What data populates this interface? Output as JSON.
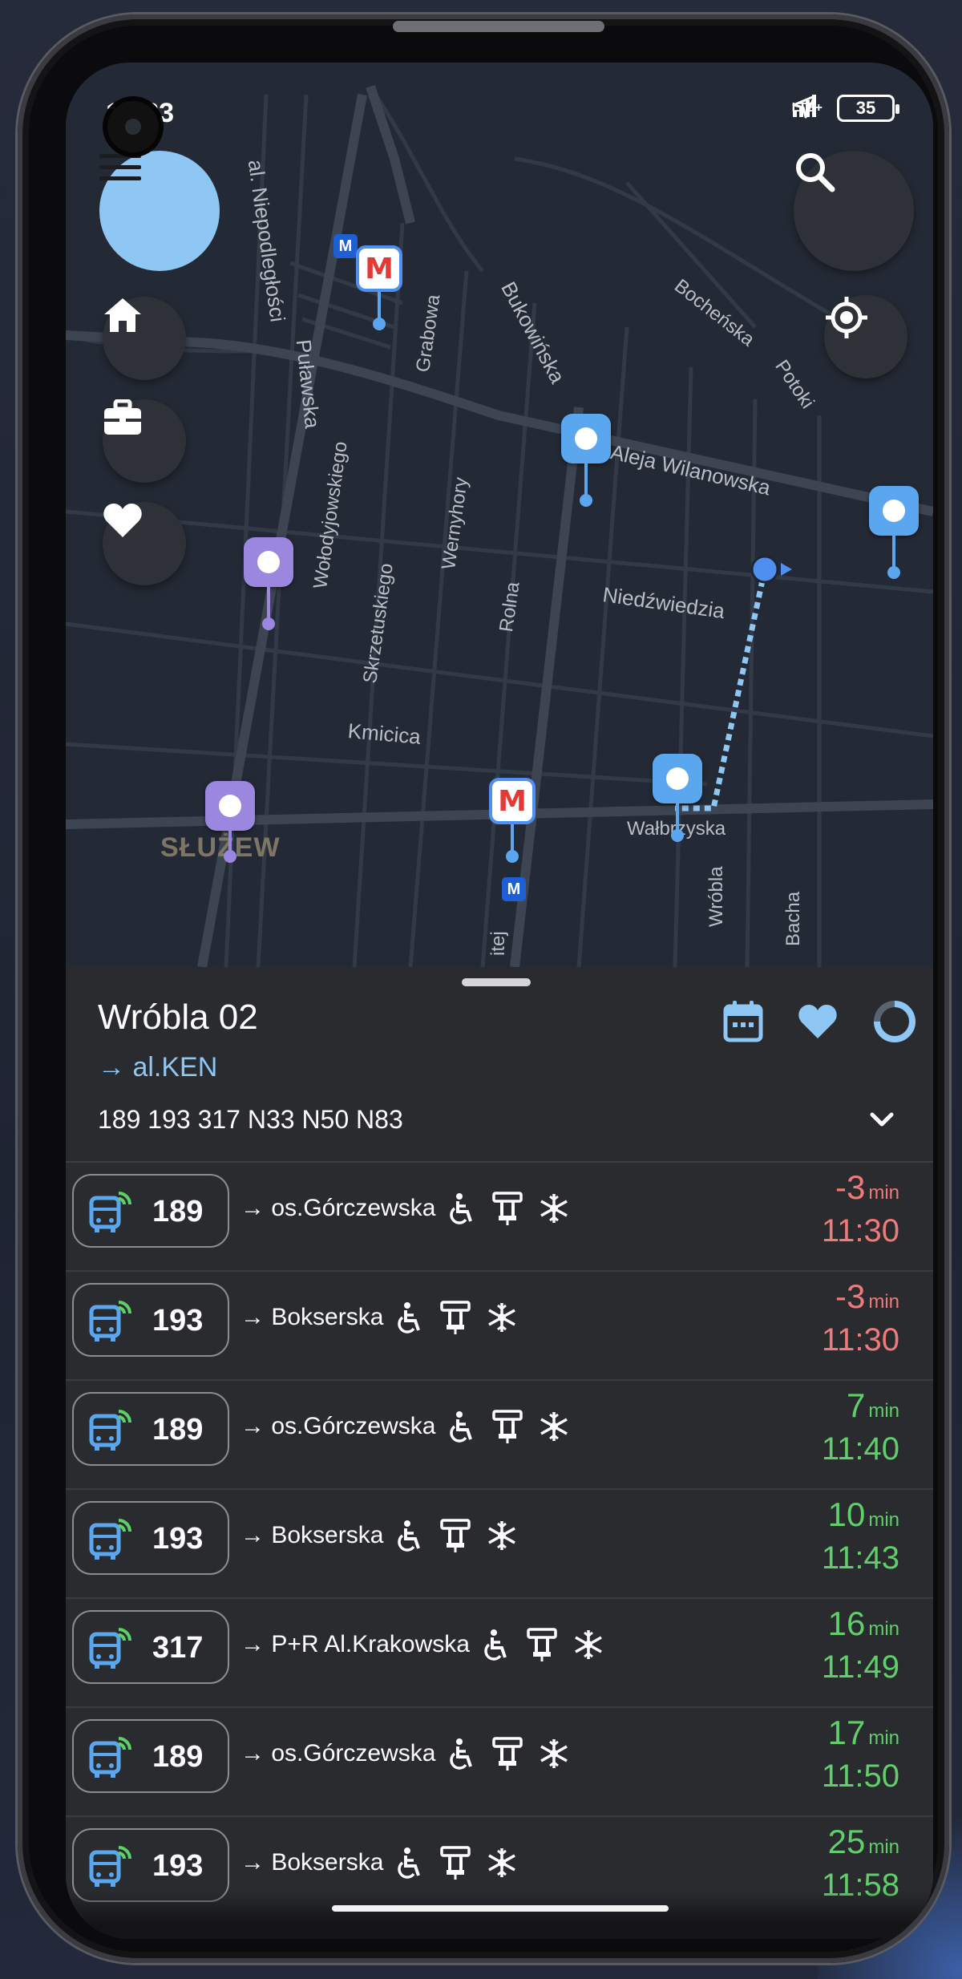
{
  "status": {
    "time": "11:33",
    "network": "LTE+",
    "battery": "35"
  },
  "map": {
    "streets": [
      {
        "label": "al. Niepodległości"
      },
      {
        "label": "Puławska"
      },
      {
        "label": "Grabowa"
      },
      {
        "label": "Bukowińska"
      },
      {
        "label": "Bocheńska"
      },
      {
        "label": "Potoki"
      },
      {
        "label": "Aleja Wilanowska"
      },
      {
        "label": "Wołodyjowskiego"
      },
      {
        "label": "Skrzetuskiego"
      },
      {
        "label": "Wernyhory"
      },
      {
        "label": "Rolna"
      },
      {
        "label": "Niedźwiedzia"
      },
      {
        "label": "Kmicica"
      },
      {
        "label": "Wałbrzyska"
      },
      {
        "label": "Wróbla"
      },
      {
        "label": "Bacha"
      },
      {
        "label": "itej"
      }
    ],
    "district": "SŁUŻEW",
    "metro_letter": "M"
  },
  "colors": {
    "accent": "#8ec6f4",
    "late": "#ef7a7a",
    "on_time": "#5fcf6a",
    "purple_stop": "#9b86e0",
    "blue_stop": "#5aa7f0"
  },
  "stop": {
    "name": "Wróbla 02",
    "direction": "→ al.KEN",
    "lines": "189 193 317 N33 N50 N83",
    "icons": [
      "calendar-icon",
      "heart-icon",
      "refresh-progress-icon",
      "chevron-down-icon"
    ]
  },
  "departures": [
    {
      "line": "189",
      "destination": "→ os.Górczewska",
      "minutes": "-3",
      "unit": "min",
      "time": "11:30",
      "status": "late"
    },
    {
      "line": "193",
      "destination": "→ Bokserska",
      "minutes": "-3",
      "unit": "min",
      "time": "11:30",
      "status": "late"
    },
    {
      "line": "189",
      "destination": "→ os.Górczewska",
      "minutes": "7",
      "unit": "min",
      "time": "11:40",
      "status": "ok"
    },
    {
      "line": "193",
      "destination": "→ Bokserska",
      "minutes": "10",
      "unit": "min",
      "time": "11:43",
      "status": "ok"
    },
    {
      "line": "317",
      "destination": "→ P+R Al.Krakowska",
      "minutes": "16",
      "unit": "min",
      "time": "11:49",
      "status": "ok"
    },
    {
      "line": "189",
      "destination": "→ os.Górczewska",
      "minutes": "17",
      "unit": "min",
      "time": "11:50",
      "status": "ok"
    },
    {
      "line": "193",
      "destination": "→ Bokserska",
      "minutes": "25",
      "unit": "min",
      "time": "11:58",
      "status": "ok"
    }
  ]
}
